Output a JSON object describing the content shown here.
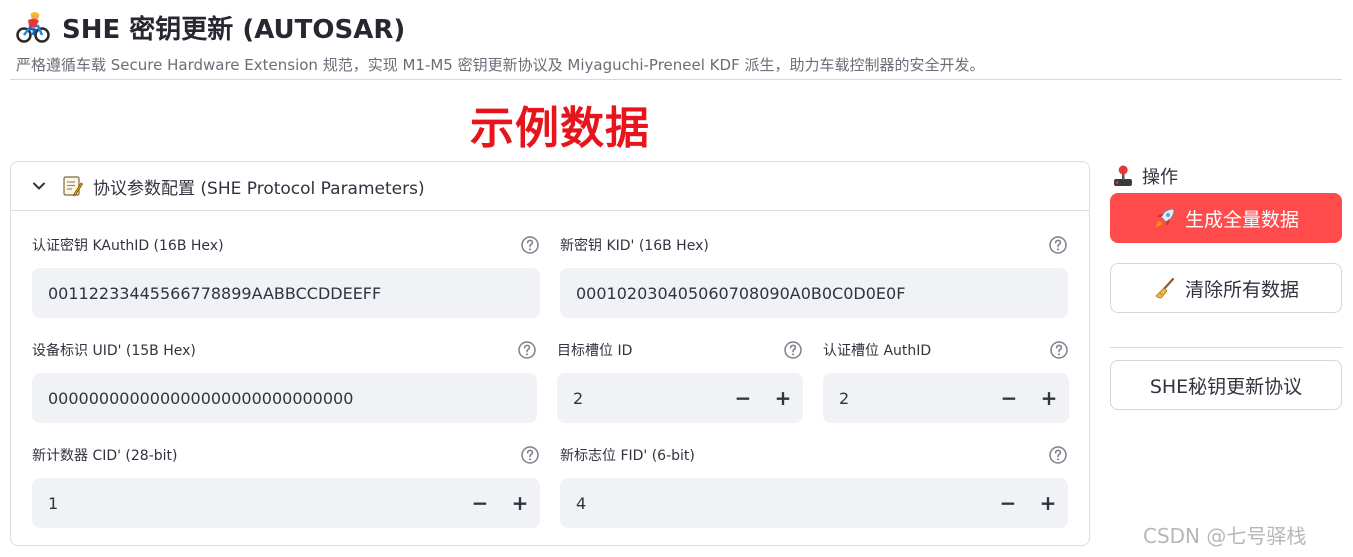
{
  "header": {
    "title": "SHE 密钥更新 (AUTOSAR)",
    "title_icon": "cyclist-icon",
    "subtitle": "严格遵循车载 Secure Hardware Extension 规范，实现 M1-M5 密钥更新协议及 Miyaguchi-Preneel KDF 派生，助力车载控制器的安全开发。"
  },
  "banner": {
    "text": "示例数据",
    "color": "#e8141c"
  },
  "expander": {
    "title": "协议参数配置 (SHE Protocol Parameters)",
    "icons": [
      "chevron-down-icon",
      "memo-icon"
    ],
    "fields": {
      "kauthid": {
        "label": "认证密钥 KAuthID (16B Hex)",
        "value": "00112233445566778899AABBCCDDEEFF"
      },
      "kid": {
        "label": "新密钥 KID' (16B Hex)",
        "value": "000102030405060708090A0B0C0D0E0F"
      },
      "uid": {
        "label": "设备标识 UID' (15B Hex)",
        "value": "000000000000000000000000000000"
      },
      "target_slot": {
        "label": "目标槽位 ID",
        "value": "2"
      },
      "auth_slot": {
        "label": "认证槽位 AuthID",
        "value": "2"
      },
      "cid": {
        "label": "新计数器 CID' (28-bit)",
        "value": "1"
      },
      "fid": {
        "label": "新标志位 FID' (6-bit)",
        "value": "4"
      }
    },
    "stepper": {
      "minus": "−",
      "plus": "+"
    }
  },
  "sidebar": {
    "label": "操作",
    "label_icon": "joystick-icon",
    "buttons": {
      "generate": {
        "label": "生成全量数据",
        "icon": "rocket-icon",
        "color": "#ff4b4b"
      },
      "clear": {
        "label": "清除所有数据",
        "icon": "broom-icon"
      },
      "protocol": {
        "label": "SHE秘钥更新协议"
      }
    }
  },
  "watermark": {
    "text": "CSDN @七号驿栈"
  }
}
